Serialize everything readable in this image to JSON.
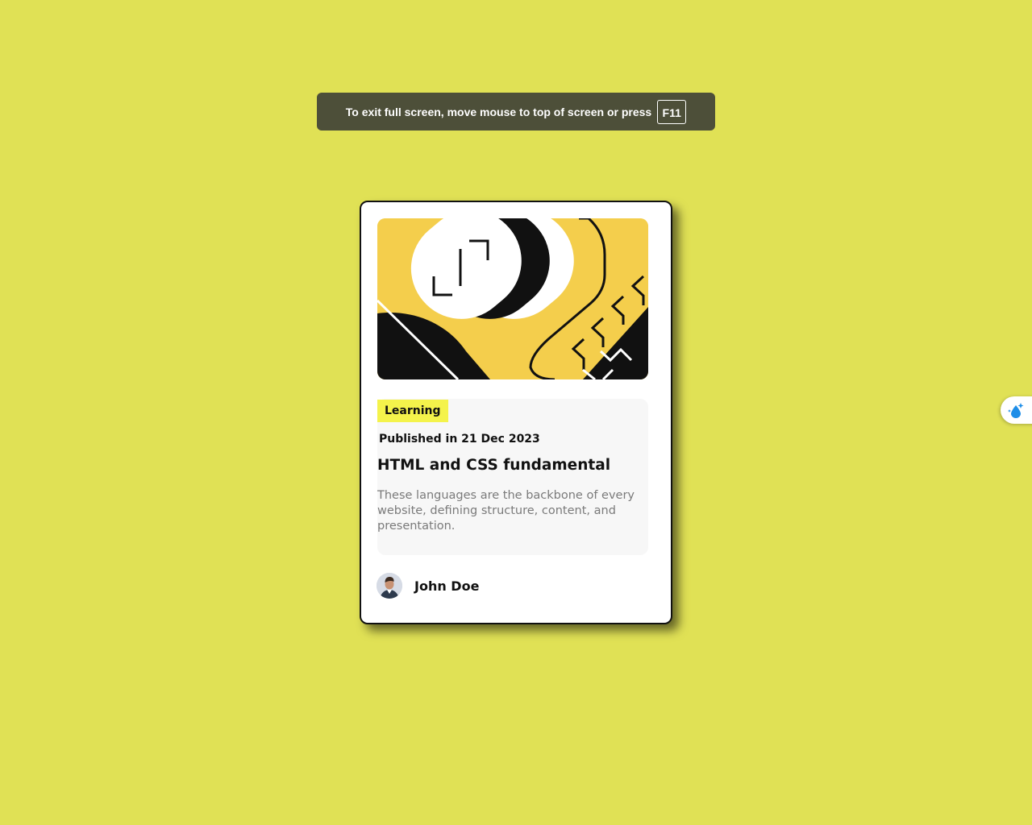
{
  "fullscreen_banner": {
    "message": "To exit full screen, move mouse to top of screen or press",
    "key": "F11"
  },
  "card": {
    "image_icon": "abstract-illustration",
    "category": "Learning",
    "published": "Published in 21 Dec 2023",
    "title": "HTML and CSS fundamental",
    "description": "These languages are the backbone of every website, defining structure, content, and presentation.",
    "author": {
      "name": "John Doe",
      "avatar_icon": "avatar-portrait"
    }
  },
  "side_widget": {
    "icon": "water-drop-sparkle-icon"
  },
  "colors": {
    "page_background": "#e0e155",
    "card_background": "#ffffff",
    "badge_background": "#f4f34b",
    "illustration_yellow": "#f4ce4c",
    "banner_background": "#4d4f39"
  }
}
